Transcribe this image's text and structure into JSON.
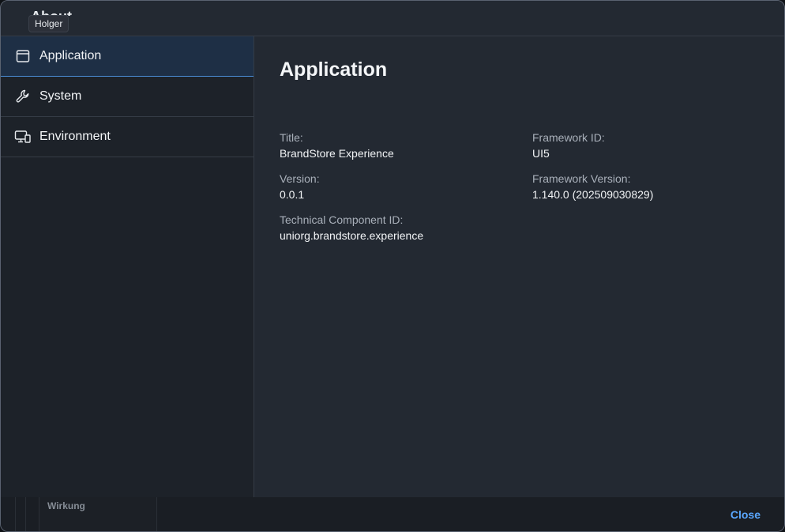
{
  "header": {
    "title": "About",
    "tooltip": "Holger"
  },
  "sidebar": {
    "items": [
      {
        "label": "Application",
        "icon": "application-icon",
        "selected": true
      },
      {
        "label": "System",
        "icon": "wrench-icon",
        "selected": false
      },
      {
        "label": "Environment",
        "icon": "devices-icon",
        "selected": false
      }
    ]
  },
  "main": {
    "title": "Application",
    "fields": {
      "title": {
        "label": "Title:",
        "value": "BrandStore Experience"
      },
      "version": {
        "label": "Version:",
        "value": "0.0.1"
      },
      "component_id": {
        "label": "Technical Component ID:",
        "value": "uniorg.brandstore.experience"
      },
      "framework_id": {
        "label": "Framework ID:",
        "value": "UI5"
      },
      "framework_version": {
        "label": "Framework Version:",
        "value": "1.140.0 (202509030829)"
      }
    }
  },
  "background": {
    "card_text": "Wirkung"
  },
  "footer": {
    "close_label": "Close"
  },
  "colors": {
    "accent": "#5aa7ff",
    "selected_bg": "#1e2f45",
    "dialog_bg": "#232932"
  }
}
